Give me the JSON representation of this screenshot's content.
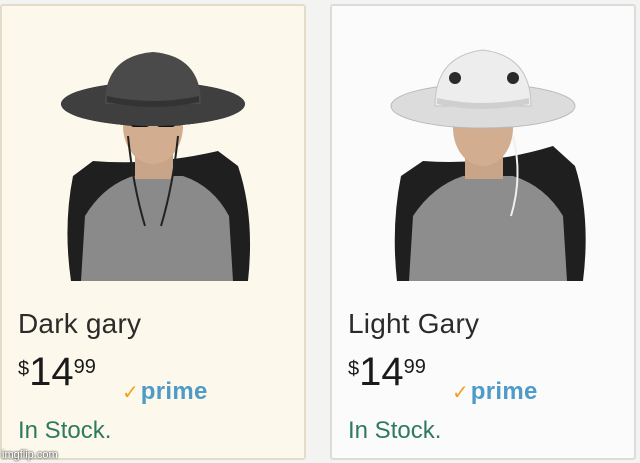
{
  "products": [
    {
      "name": "Dark gary",
      "price_symbol": "$",
      "price_whole": "14",
      "price_fraction": "99",
      "badge": "prime",
      "stock": "In Stock.",
      "hat_color": "#4a4a4a"
    },
    {
      "name": "Light Gary",
      "price_symbol": "$",
      "price_whole": "14",
      "price_fraction": "99",
      "badge": "prime",
      "stock": "In Stock.",
      "hat_color": "#e6e6e6"
    }
  ],
  "watermark": "imgflip.com",
  "colors": {
    "stock_green": "#2f7a5f",
    "prime_blue": "#4d9bc6",
    "prime_check": "#f0a21c"
  }
}
